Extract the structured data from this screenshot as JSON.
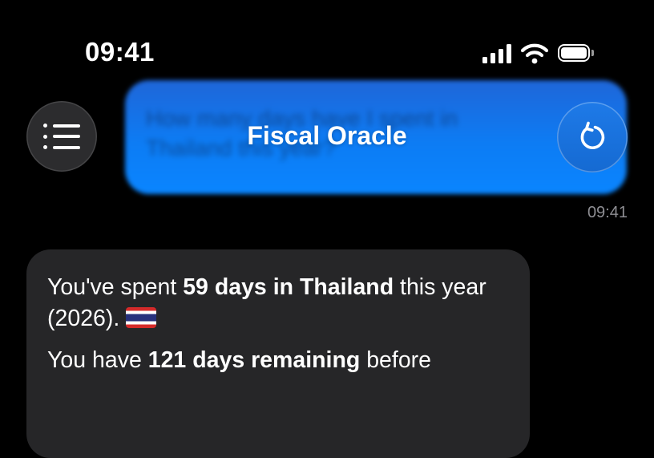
{
  "status_bar": {
    "time": "09:41"
  },
  "header": {
    "title": "Fiscal Oracle",
    "menu_icon": "list-icon",
    "refresh_icon": "refresh-icon"
  },
  "user_message": {
    "text": "How many days have I spent in Thailand this year?",
    "timestamp": "09:41"
  },
  "assistant_message": {
    "p1": {
      "pre": "You've spent ",
      "bold": "59 days in Thailand",
      "post": " this year (2026).",
      "flag": "thailand-flag"
    },
    "p2": {
      "pre": "You have ",
      "bold": "121 days remaining",
      "post": " before"
    }
  },
  "colors": {
    "user_bubble": "#0d7cf4",
    "assistant_bubble": "#262628",
    "background": "#000000",
    "timestamp": "#8e8e93"
  }
}
